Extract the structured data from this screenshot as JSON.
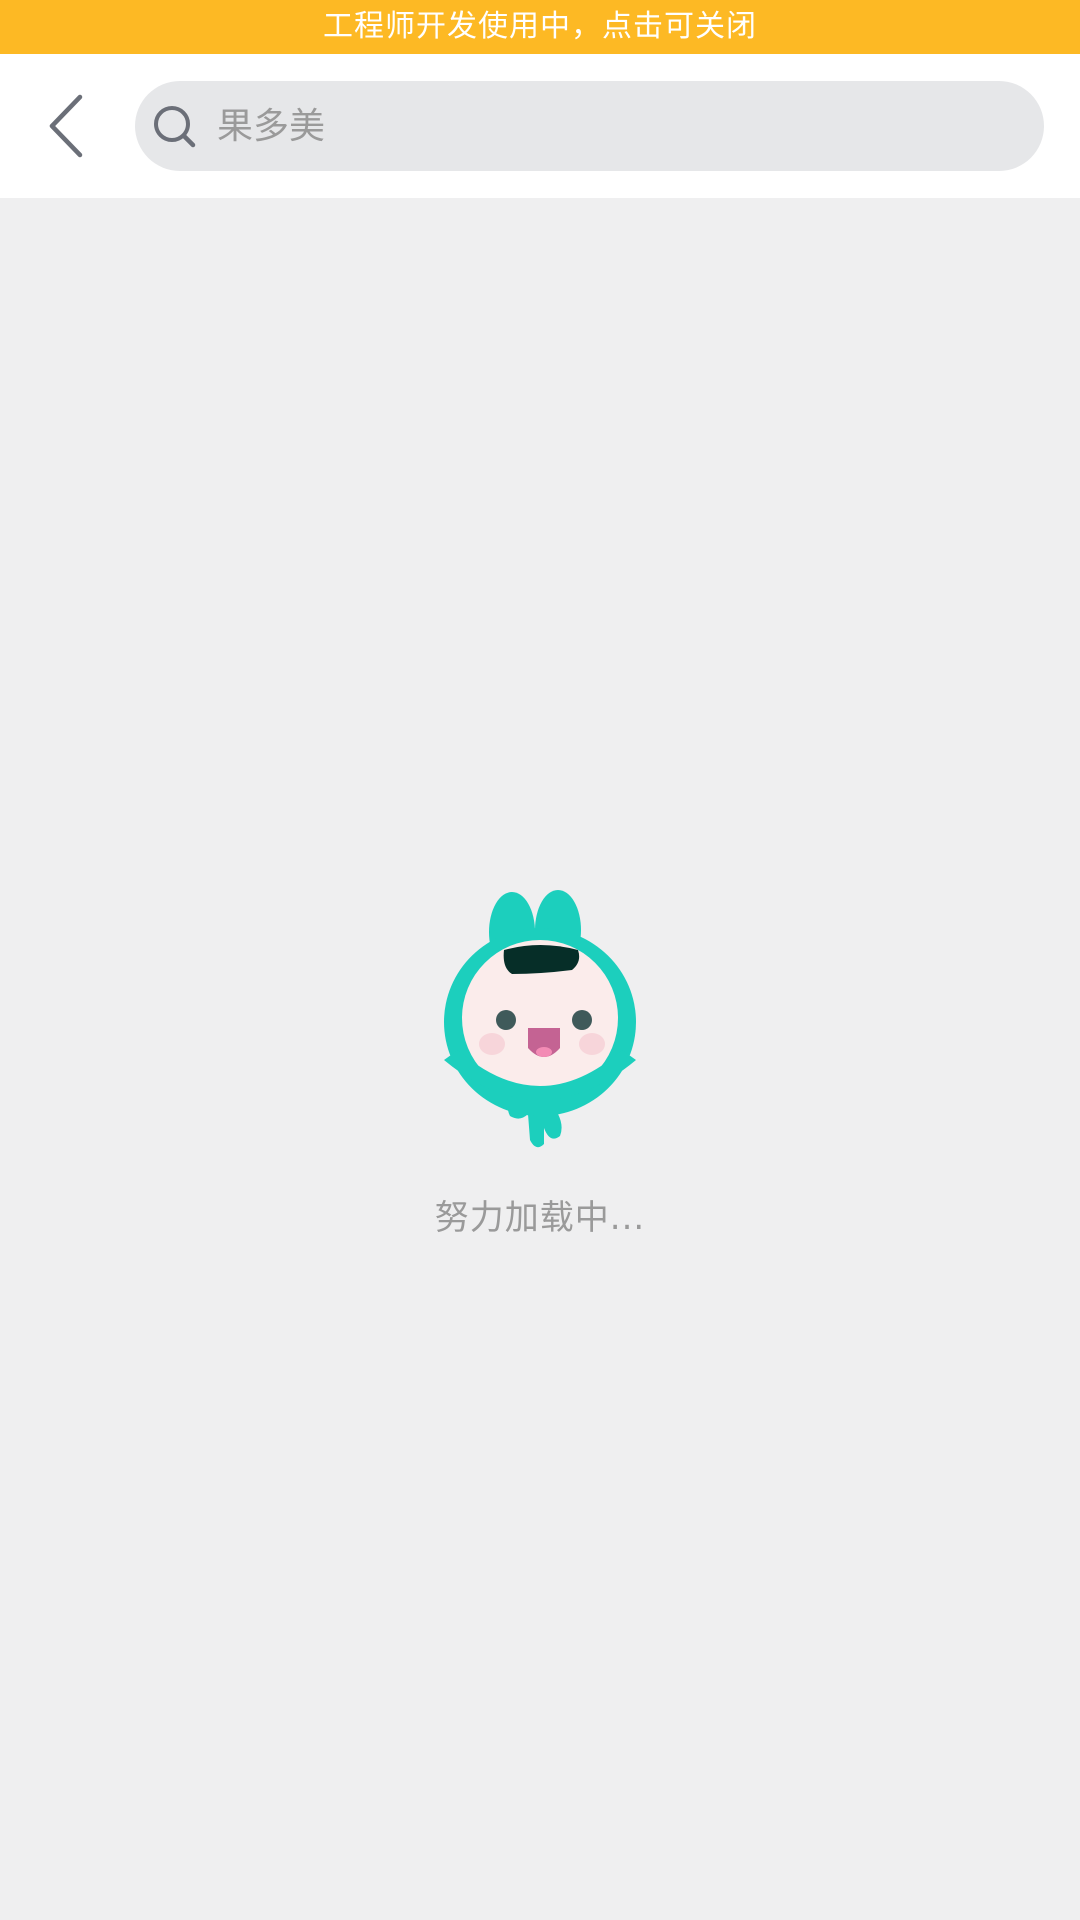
{
  "dev_banner": {
    "text": "工程师开发使用中，点击可关闭",
    "color": "#fdb924"
  },
  "header": {
    "back_icon": "chevron-left-icon",
    "search": {
      "icon": "search-icon",
      "placeholder": "果多美",
      "value": ""
    }
  },
  "loading": {
    "mascot": "teal-bunny-mascot",
    "text": "努力加载中..."
  }
}
